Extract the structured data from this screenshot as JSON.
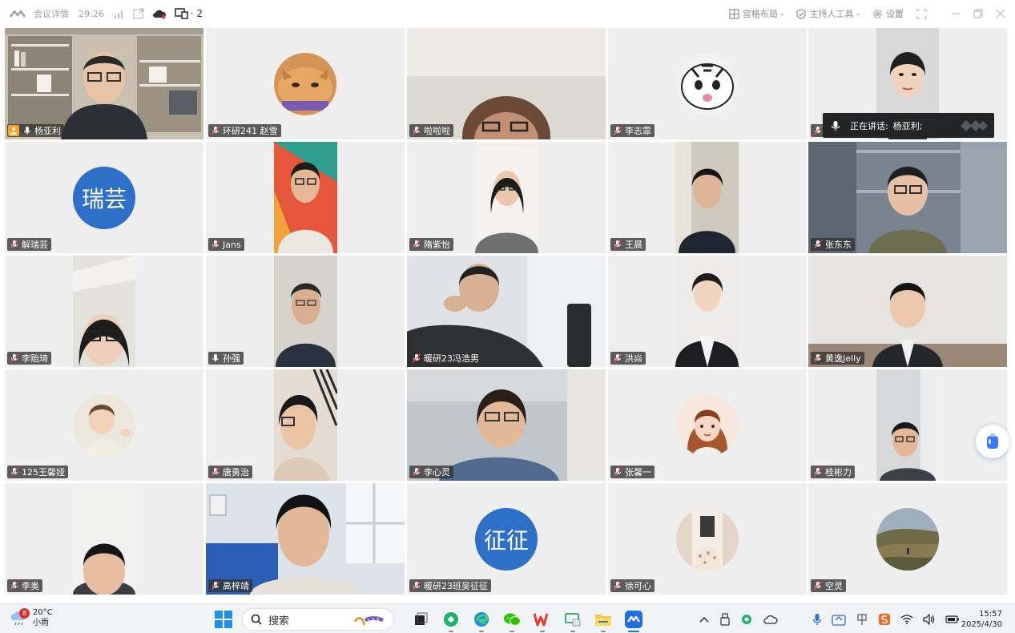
{
  "window": {
    "meeting_details": "会议详情",
    "timer": "29:26",
    "device_count": "· 2"
  },
  "toolbar": {
    "layout_label": "宫格布局",
    "host_tools_label": "主持人工具",
    "settings_label": "设置"
  },
  "participants": [
    {
      "name": "杨亚利",
      "type": "video",
      "host": true,
      "active": true,
      "mic": "on"
    },
    {
      "name": "环研241 赵雪",
      "type": "avatar",
      "avatar_kind": "cat",
      "mic": "muted"
    },
    {
      "name": "啦啦啦",
      "type": "video",
      "mic": "muted"
    },
    {
      "name": "李志霏",
      "type": "avatar",
      "avatar_kind": "tiger",
      "mic": "muted"
    },
    {
      "name": "",
      "type": "video",
      "mic": "muted"
    },
    {
      "name": "解瑞芸",
      "type": "avatar-text",
      "avatar_text": "瑞芸",
      "mic": "muted"
    },
    {
      "name": "Jans",
      "type": "video",
      "mic": "muted"
    },
    {
      "name": "隋紫怡",
      "type": "video",
      "mic": "muted"
    },
    {
      "name": "王晨",
      "type": "video",
      "mic": "muted"
    },
    {
      "name": "张东东",
      "type": "video",
      "mic": "muted"
    },
    {
      "name": "李贻琦",
      "type": "video",
      "mic": "muted"
    },
    {
      "name": "孙强",
      "type": "video",
      "mic": "on"
    },
    {
      "name": "暖研23冯浩男",
      "type": "video",
      "mic": "muted"
    },
    {
      "name": "洪焱",
      "type": "video",
      "mic": "muted"
    },
    {
      "name": "黄逸Jelly",
      "type": "video",
      "mic": "muted"
    },
    {
      "name": "125王馨娅",
      "type": "avatar",
      "avatar_kind": "child",
      "mic": "muted"
    },
    {
      "name": "唐勇治",
      "type": "video",
      "mic": "muted"
    },
    {
      "name": "李心灵",
      "type": "video",
      "mic": "muted"
    },
    {
      "name": "张馨一",
      "type": "avatar",
      "avatar_kind": "girl",
      "mic": "muted"
    },
    {
      "name": "桂彬力",
      "type": "video",
      "mic": "muted"
    },
    {
      "name": "李奥",
      "type": "video",
      "mic": "muted"
    },
    {
      "name": "高梓靖",
      "type": "video",
      "mic": "muted"
    },
    {
      "name": "暖研23班吴征征",
      "type": "avatar-text",
      "avatar_text": "征征",
      "mic": "muted"
    },
    {
      "name": "徐可心",
      "type": "avatar",
      "avatar_kind": "photo",
      "mic": "muted"
    },
    {
      "name": "空灵",
      "type": "avatar",
      "avatar_kind": "landscape",
      "mic": "muted"
    }
  ],
  "speaking": {
    "label": "正在讲话:",
    "speaker": "杨亚利;"
  },
  "taskbar": {
    "weather_badge": "8",
    "temperature": "20°C",
    "condition": "小雨",
    "search_label": "搜索",
    "time": "15:57",
    "date": "2025/4/30"
  },
  "colors": {
    "active_border": "#52c49a",
    "avatar_blue": "#2e6fc7",
    "host_badge": "#f5a623"
  }
}
